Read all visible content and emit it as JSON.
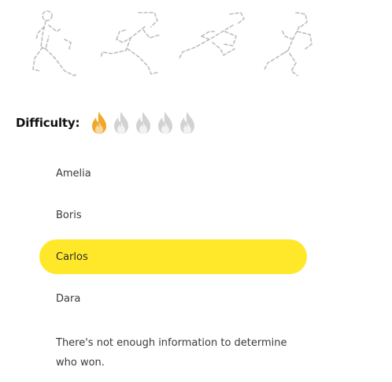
{
  "runners": {
    "icons": [
      "runner-1-icon",
      "runner-2-icon",
      "runner-3-icon",
      "runner-4-icon"
    ],
    "stroke_color": "#bdbdbd"
  },
  "difficulty": {
    "label": "Difficulty:",
    "level": 1,
    "max": 5,
    "active_color": "#f0a82a",
    "inactive_color": "#d2d2d2"
  },
  "question": {
    "options": [
      {
        "label": "Amelia",
        "selected": false
      },
      {
        "label": "Boris",
        "selected": false
      },
      {
        "label": "Carlos",
        "selected": true
      },
      {
        "label": "Dara",
        "selected": false
      },
      {
        "label": "There's not enough information to determine who won.",
        "selected": false
      }
    ],
    "selected_color": "#ffe82a"
  }
}
